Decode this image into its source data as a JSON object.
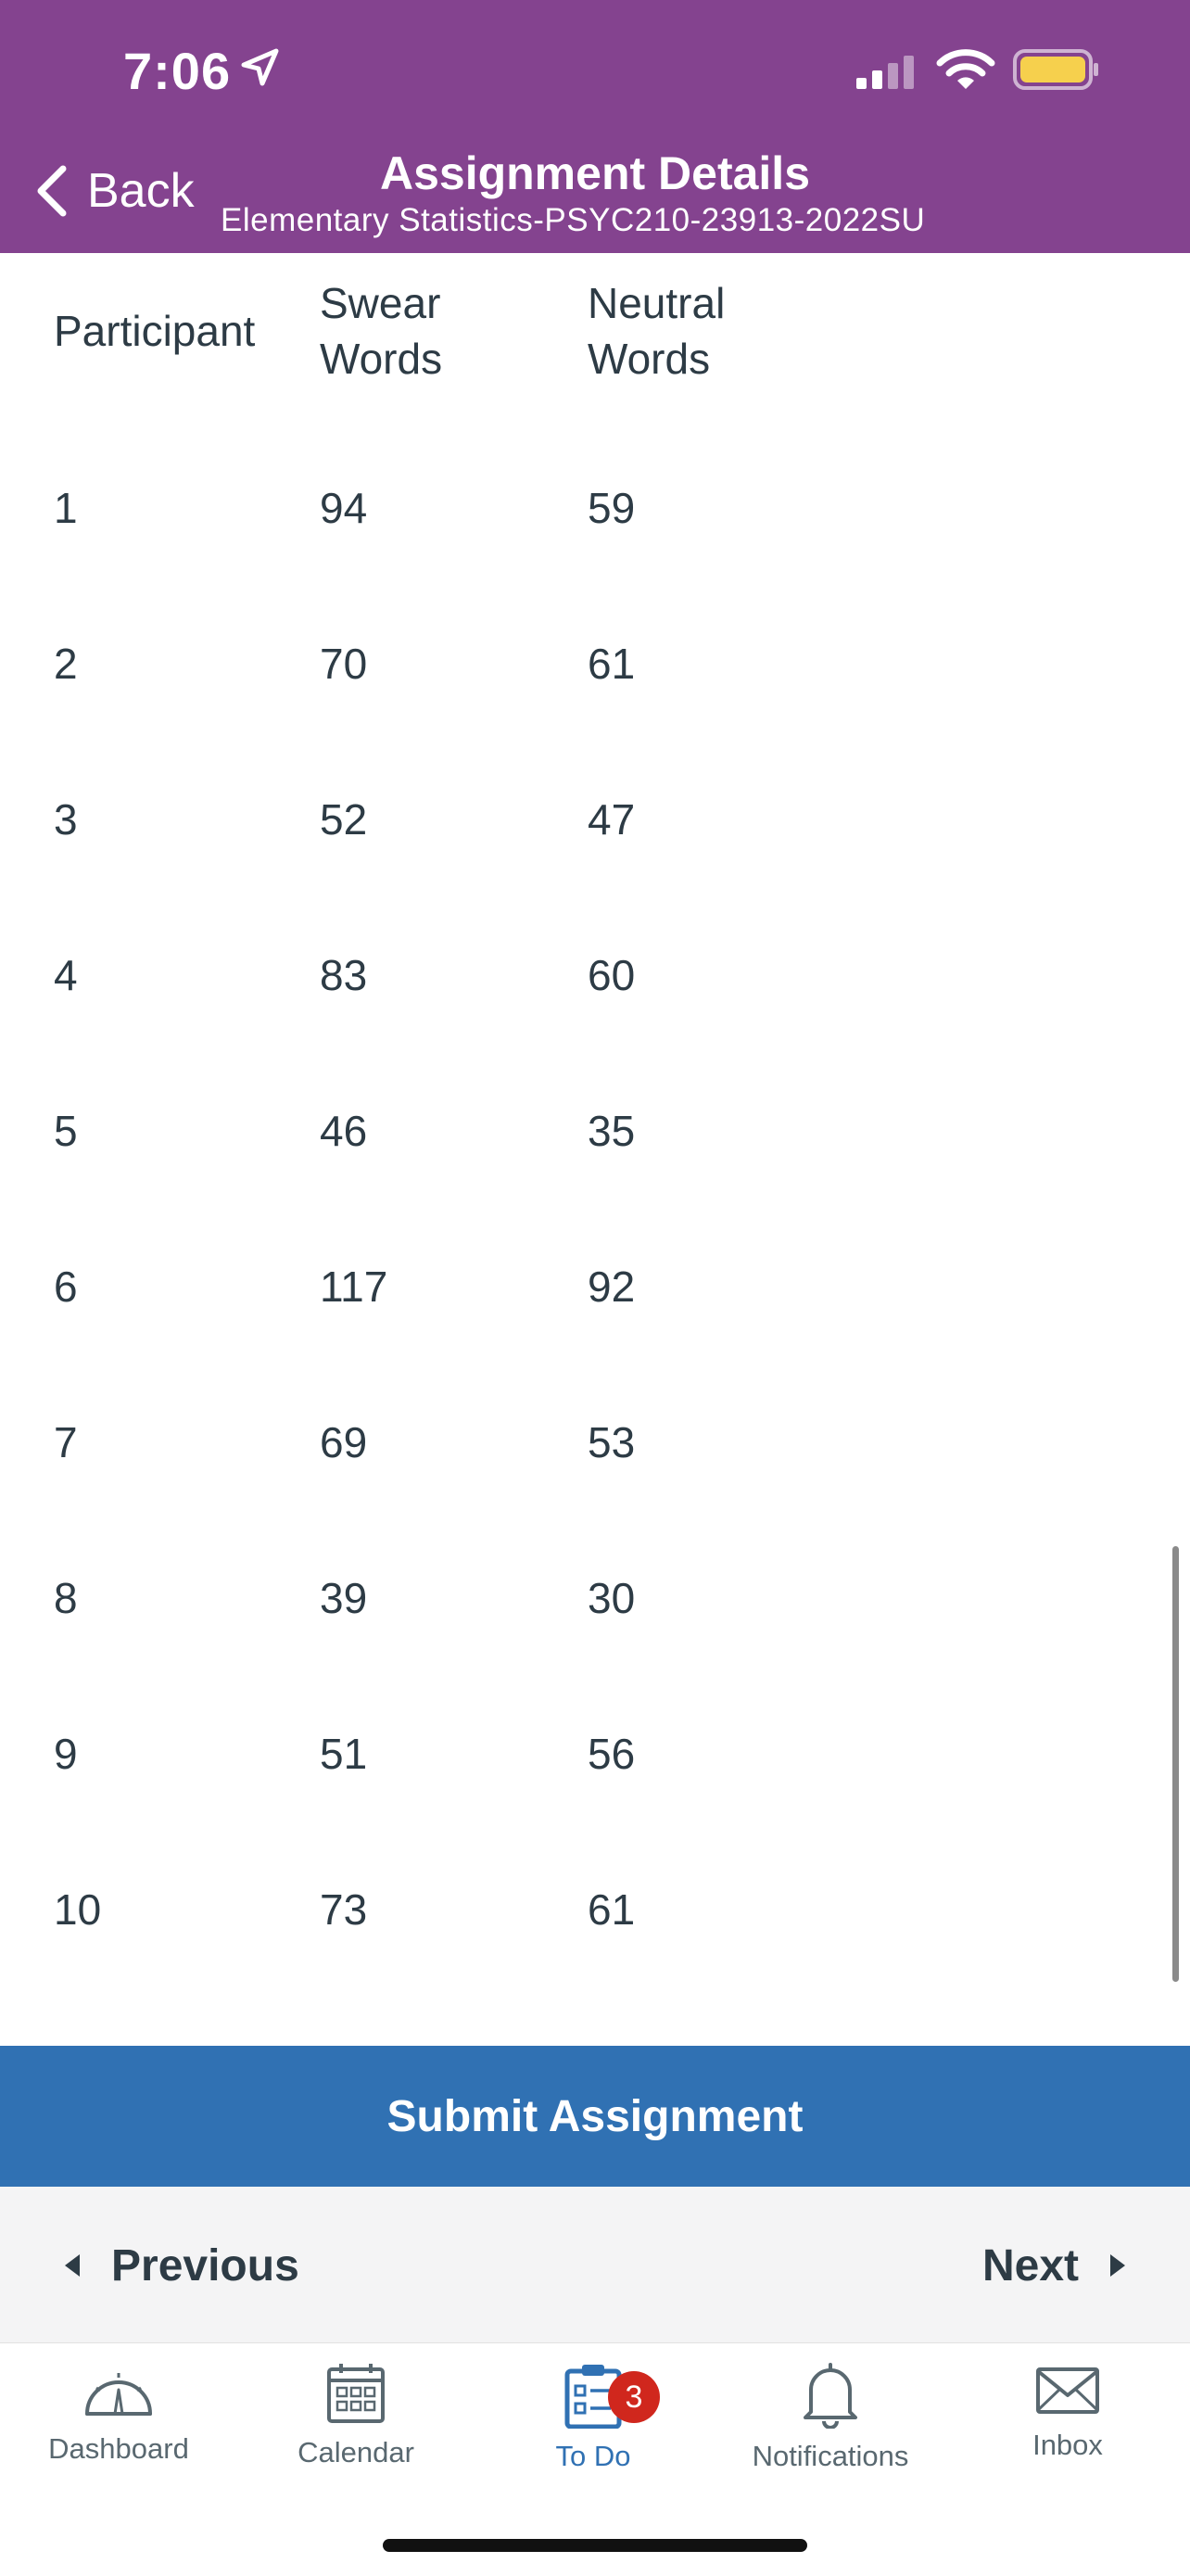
{
  "status_bar": {
    "time": "7:06"
  },
  "nav": {
    "back_label": "Back",
    "title": "Assignment Details",
    "subtitle": "Elementary Statistics-PSYC210-23913-2022SU"
  },
  "table": {
    "headers": [
      {
        "line1": "Participant",
        "line2": ""
      },
      {
        "line1": "Swear",
        "line2": "Words"
      },
      {
        "line1": "Neutral",
        "line2": "Words"
      }
    ],
    "rows": [
      [
        "1",
        "94",
        "59"
      ],
      [
        "2",
        "70",
        "61"
      ],
      [
        "3",
        "52",
        "47"
      ],
      [
        "4",
        "83",
        "60"
      ],
      [
        "5",
        "46",
        "35"
      ],
      [
        "6",
        "117",
        "92"
      ],
      [
        "7",
        "69",
        "53"
      ],
      [
        "8",
        "39",
        "30"
      ],
      [
        "9",
        "51",
        "56"
      ],
      [
        "10",
        "73",
        "61"
      ]
    ]
  },
  "actions": {
    "submit_label": "Submit Assignment"
  },
  "pager": {
    "previous_label": "Previous",
    "next_label": "Next"
  },
  "tabbar": {
    "tabs": [
      {
        "label": "Dashboard",
        "icon": "dashboard-icon"
      },
      {
        "label": "Calendar",
        "icon": "calendar-icon"
      },
      {
        "label": "To Do",
        "icon": "todo-icon",
        "badge": "3",
        "active": true
      },
      {
        "label": "Notifications",
        "icon": "bell-icon"
      },
      {
        "label": "Inbox",
        "icon": "envelope-icon"
      }
    ]
  },
  "colors": {
    "header": "#84438f",
    "submit": "#3071b3",
    "active_tab": "#3071b3",
    "badge": "#d0271d",
    "battery": "#f6d04d"
  }
}
